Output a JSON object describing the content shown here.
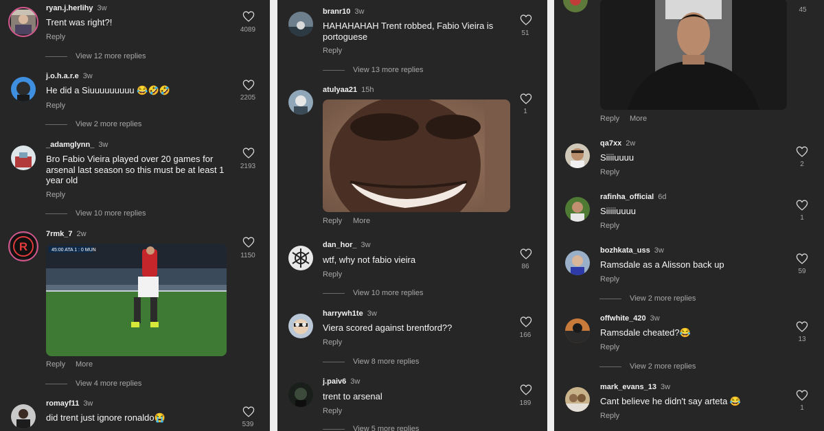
{
  "p1": {
    "c1": {
      "user": "ryan.j.herlihy",
      "time": "3w",
      "text": "Trent was right?!",
      "reply": "Reply",
      "views": "View 12 more replies",
      "likes": "4089"
    },
    "c2": {
      "user": "j.o.h.a.r.e",
      "time": "3w",
      "text": "He did a Siuuuuuuuuu 😂🤣🤣",
      "reply": "Reply",
      "views": "View 2 more replies",
      "likes": "2205"
    },
    "c3": {
      "user": "_adamglynn_",
      "time": "3w",
      "text": "Bro Fabio Vieira played over 20 games for arsenal last season so this must be at least 1 year old",
      "reply": "Reply",
      "views": "View 10 more replies",
      "likes": "2193"
    },
    "c4": {
      "user": "7rmk_7",
      "time": "2w",
      "reply": "Reply",
      "more": "More",
      "views": "View 4 more replies",
      "likes": "1150",
      "score": "45:00  ATA 1 : 0 MUN"
    },
    "c5": {
      "user": "romayf11",
      "time": "3w",
      "text": "did trent just ignore ronaldo😭",
      "likes": "539"
    }
  },
  "p2": {
    "c1": {
      "user": "branr10",
      "time": "3w",
      "text": "HAHAHAHAH Trent robbed, Fabio Vieira is portoguese",
      "reply": "Reply",
      "views": "View 13 more replies",
      "likes": "51"
    },
    "c2": {
      "user": "atulyaa21",
      "time": "15h",
      "reply": "Reply",
      "more": "More",
      "likes": "1"
    },
    "c3": {
      "user": "dan_hor_",
      "time": "3w",
      "text": "wtf, why not fabio vieira",
      "reply": "Reply",
      "views": "View 10 more replies",
      "likes": "86"
    },
    "c4": {
      "user": "harrywh1te",
      "time": "3w",
      "text": "Viera scored against brentford??",
      "reply": "Reply",
      "views": "View 8 more replies",
      "likes": "166"
    },
    "c5": {
      "user": "j.paiv6",
      "time": "3w",
      "text": "trent to arsenal",
      "reply": "Reply",
      "views": "View 5 more replies",
      "likes": "189"
    }
  },
  "p3": {
    "c0": {
      "reply": "Reply",
      "more": "More",
      "likes": "45"
    },
    "c1": {
      "user": "qa7xx",
      "time": "2w",
      "text": "Siiiiuuuu",
      "reply": "Reply",
      "likes": "2"
    },
    "c2": {
      "user": "rafinha_official",
      "time": "6d",
      "text": "Siiiiiuuuu",
      "reply": "Reply",
      "likes": "1"
    },
    "c3": {
      "user": "bozhkata_uss",
      "time": "3w",
      "text": "Ramsdale as a Alisson back up",
      "reply": "Reply",
      "views": "View 2 more replies",
      "likes": "59"
    },
    "c4": {
      "user": "offwhite_420",
      "time": "3w",
      "text": "Ramsdale cheated?😂",
      "reply": "Reply",
      "views": "View 2 more replies",
      "likes": "13"
    },
    "c5": {
      "user": "mark_evans_13",
      "time": "3w",
      "text": "Cant believe he didn't say arteta 😂",
      "reply": "Reply",
      "likes": "1"
    }
  },
  "colors": {
    "bg": "#262626",
    "text": "#f5f5f5",
    "muted": "#a8a8a8",
    "story_ring": "#d5588e"
  },
  "icons": {
    "like": "heart-outline-icon"
  }
}
